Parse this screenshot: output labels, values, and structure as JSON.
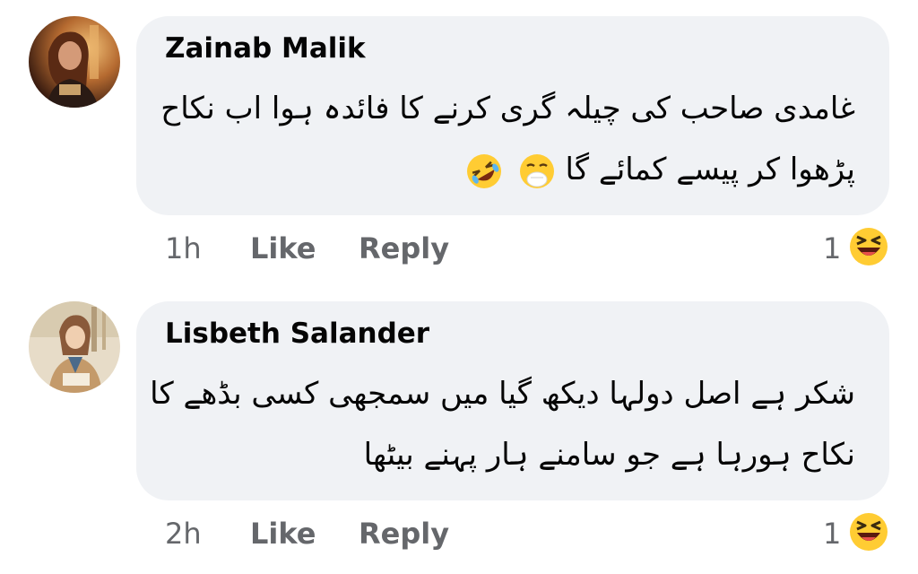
{
  "comments": [
    {
      "author": "Zainab Malik",
      "lines": [
        "غامدی صاحب کی چیلہ گری کرنے کا فائدہ ہوا اب نکاح",
        "پڑھوا کر پیسے کمائے گا"
      ],
      "emojis": [
        "rolling-on-floor-laughing-icon",
        "laughing-hand-over-mouth-icon"
      ],
      "time": "1h",
      "like_label": "Like",
      "reply_label": "Reply",
      "reaction_count": "1",
      "reaction_icon": "laughing-squint-emoji-icon"
    },
    {
      "author": "Lisbeth Salander",
      "lines": [
        "شکر ہے اصل دولہا دیکھ گیا میں سمجھی کسی بڈھے کا",
        "نکاح ہورہا ہے جو سامنے ہار پہنے بیٹھا"
      ],
      "time": "2h",
      "like_label": "Like",
      "reply_label": "Reply",
      "reaction_count": "1",
      "reaction_icon": "laughing-squint-emoji-icon"
    }
  ],
  "colors": {
    "bubble": "#f0f2f5",
    "meta_text": "#65676b",
    "name_text": "#050505",
    "emoji_yellow": "#ffcc33"
  }
}
